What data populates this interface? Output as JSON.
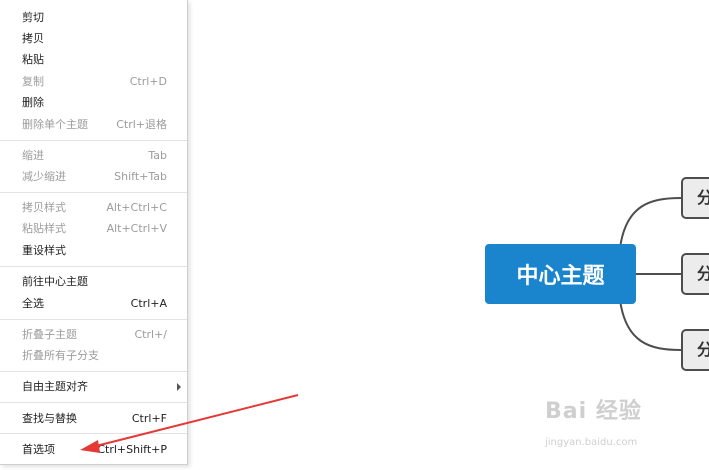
{
  "menu": {
    "items": [
      {
        "label": "剪切",
        "shortcut": "",
        "enabled": true
      },
      {
        "label": "拷贝",
        "shortcut": "",
        "enabled": true
      },
      {
        "label": "粘贴",
        "shortcut": "",
        "enabled": true
      },
      {
        "label": "复制",
        "shortcut": "Ctrl+D",
        "enabled": false
      },
      {
        "label": "删除",
        "shortcut": "",
        "enabled": true
      },
      {
        "label": "删除单个主题",
        "shortcut": "Ctrl+退格",
        "enabled": false
      },
      {
        "label": "缩进",
        "shortcut": "Tab",
        "enabled": false
      },
      {
        "label": "减少缩进",
        "shortcut": "Shift+Tab",
        "enabled": false
      },
      {
        "label": "拷贝样式",
        "shortcut": "Alt+Ctrl+C",
        "enabled": false
      },
      {
        "label": "粘贴样式",
        "shortcut": "Alt+Ctrl+V",
        "enabled": false
      },
      {
        "label": "重设样式",
        "shortcut": "",
        "enabled": true
      },
      {
        "label": "前往中心主题",
        "shortcut": "",
        "enabled": true
      },
      {
        "label": "全选",
        "shortcut": "Ctrl+A",
        "enabled": true
      },
      {
        "label": "折叠子主题",
        "shortcut": "Ctrl+/",
        "enabled": false
      },
      {
        "label": "折叠所有子分支",
        "shortcut": "",
        "enabled": false
      },
      {
        "label": "自由主题对齐",
        "shortcut": "",
        "enabled": true
      },
      {
        "label": "查找与替换",
        "shortcut": "Ctrl+F",
        "enabled": true
      },
      {
        "label": "首选项",
        "shortcut": "Ctrl+Shift+P",
        "enabled": true
      }
    ]
  },
  "mindmap": {
    "central_topic": "中心主题",
    "subtopics": [
      "分",
      "分",
      "分"
    ],
    "central_color": "#1a84cc"
  },
  "watermark": {
    "brand": "Bai 经验",
    "url": "jingyan.baidu.com"
  },
  "annotation": {
    "arrow_color": "#e53935"
  }
}
